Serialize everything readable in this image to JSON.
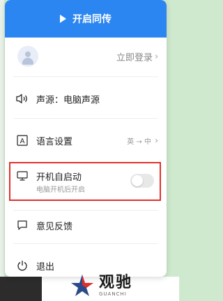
{
  "sync_button": {
    "label": "开启同传"
  },
  "login": {
    "label": "立即登录",
    "chevron": "›"
  },
  "sound_source": {
    "label": "声源：电脑声源"
  },
  "language": {
    "label": "语言设置",
    "value": "英 → 中",
    "chevron": "›"
  },
  "autostart": {
    "label": "开机自启动",
    "sublabel": "电脑开机后开启",
    "enabled": false
  },
  "feedback": {
    "label": "意见反馈"
  },
  "logout": {
    "label": "退出"
  },
  "watermark": {
    "brand": "观驰",
    "brand_sub": "GUANCHI"
  },
  "colors": {
    "accent": "#2b86f1",
    "highlight": "#e0302b"
  }
}
